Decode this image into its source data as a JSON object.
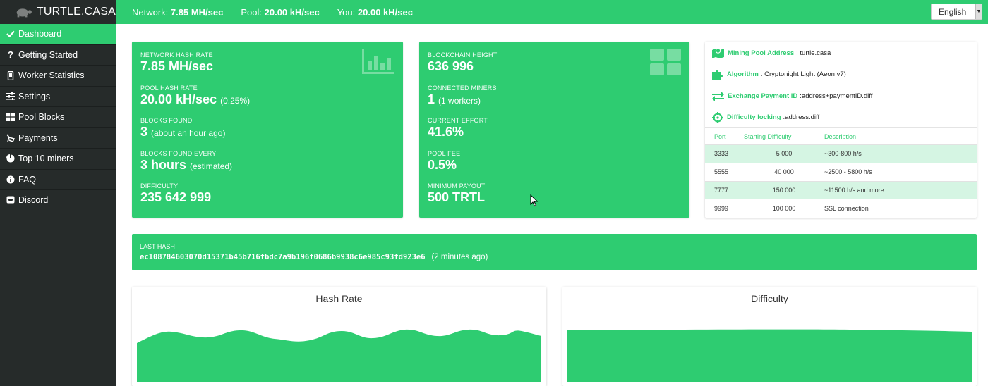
{
  "header": {
    "brand": "TURTLE.CASA",
    "stats": [
      {
        "label": "Network:",
        "value": "7.85 MH/sec"
      },
      {
        "label": "Pool:",
        "value": "20.00 kH/sec"
      },
      {
        "label": "You:",
        "value": "20.00 kH/sec"
      }
    ],
    "language": "English"
  },
  "sidebar": {
    "items": [
      {
        "label": "Dashboard",
        "icon": "check-icon",
        "active": true
      },
      {
        "label": "Getting Started",
        "icon": "question-icon"
      },
      {
        "label": "Worker Statistics",
        "icon": "mobile-icon"
      },
      {
        "label": "Settings",
        "icon": "sliders-icon"
      },
      {
        "label": "Pool Blocks",
        "icon": "grid-icon"
      },
      {
        "label": "Payments",
        "icon": "wallet-icon"
      },
      {
        "label": "Top 10 miners",
        "icon": "pie-icon"
      },
      {
        "label": "FAQ",
        "icon": "info-icon"
      },
      {
        "label": "Discord",
        "icon": "discord-icon"
      }
    ]
  },
  "network_card": {
    "metrics": [
      {
        "label": "NETWORK HASH RATE",
        "value": "7.85 MH/sec",
        "sub": ""
      },
      {
        "label": "POOL HASH RATE",
        "value": "20.00 kH/sec",
        "sub": "(0.25%)"
      },
      {
        "label": "BLOCKS FOUND",
        "value": "3",
        "sub": "(about an hour ago)"
      },
      {
        "label": "BLOCKS FOUND EVERY",
        "value": "3 hours",
        "sub": "(estimated)"
      },
      {
        "label": "DIFFICULTY",
        "value": "235 642 999",
        "sub": ""
      }
    ]
  },
  "chain_card": {
    "metrics": [
      {
        "label": "BLOCKCHAIN HEIGHT",
        "value": "636 996",
        "sub": ""
      },
      {
        "label": "CONNECTED MINERS",
        "value": "1",
        "sub": "(1 workers)"
      },
      {
        "label": "CURRENT EFFORT",
        "value": "41.6%",
        "sub": ""
      },
      {
        "label": "POOL FEE",
        "value": "0.5%",
        "sub": ""
      },
      {
        "label": "MINIMUM PAYOUT",
        "value": "500 TRTL",
        "sub": ""
      }
    ]
  },
  "info": {
    "pool_address_label": "Mining Pool Address",
    "pool_address": ": turtle.casa",
    "algorithm_label": "Algorithm",
    "algorithm": ": Cryptonight Light (Aeon v7)",
    "payment_id_label": "Exchange Payment ID",
    "payment_id_sep": ": ",
    "payment_id_a": "address",
    "payment_id_b": "+paymentID",
    "payment_id_c": ".diff",
    "diff_lock_label": "Difficulty locking",
    "diff_lock_sep": ": ",
    "diff_lock_a": "address",
    "diff_lock_b": " . ",
    "diff_lock_c": "diff"
  },
  "ports": {
    "headers": [
      "Port",
      "Starting Difficulty",
      "Description"
    ],
    "rows": [
      [
        "3333",
        "5 000",
        "~300-800 h/s"
      ],
      [
        "5555",
        "40 000",
        "~2500 - 5800 h/s"
      ],
      [
        "7777",
        "150 000",
        "~11500 h/s and more"
      ],
      [
        "9999",
        "100 000",
        "SSL connection"
      ]
    ]
  },
  "last_hash": {
    "label": "LAST HASH",
    "hash": "ec108784603070d15371b45b716fbdc7a9b196f0686b9938c6e985c93fd923e6",
    "ago": "(2 minutes ago)"
  },
  "charts": {
    "hashrate_title": "Hash Rate",
    "difficulty_title": "Difficulty",
    "color": "#2ecc71"
  },
  "colors": {
    "accent": "#2ecc71",
    "sidebar": "#262b2a",
    "row_alt": "#d5f5e3"
  }
}
